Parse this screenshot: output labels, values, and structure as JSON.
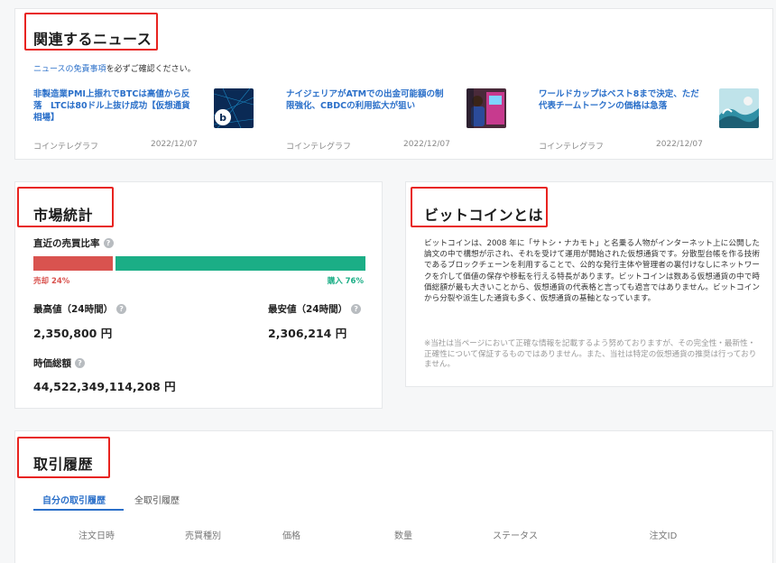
{
  "news": {
    "title": "関連するニュース",
    "disclaimer_link": "ニュースの免責事項",
    "disclaimer_text": "を必ずご確認ください。",
    "items": [
      {
        "title": "非製造業PMI上振れでBTCは高値から反落　LTCは80ドル上抜け成功【仮想通貨相場】",
        "source": "コインテレグラフ",
        "date": "2022/12/07",
        "thumb": "bitbank-logo"
      },
      {
        "title": "ナイジェリアがATMでの出金可能額の制限強化、CBDCの利用拡大が狙い",
        "source": "コインテレグラフ",
        "date": "2022/12/07",
        "thumb": "atm-photo"
      },
      {
        "title": "ワールドカップはベスト8まで決定、ただ代表チームトークンの価格は急落",
        "source": "コインテレグラフ",
        "date": "2022/12/07",
        "thumb": "wave-photo"
      }
    ]
  },
  "stats": {
    "title": "市場統計",
    "ratio_label": "直近の売買比率",
    "sell_label": "売却 24%",
    "buy_label": "購入 76%",
    "sell_pct": 24,
    "buy_pct": 76,
    "high_label": "最高値（24時間）",
    "high_value": "2,350,800 円",
    "low_label": "最安値（24時間）",
    "low_value": "2,306,214 円",
    "cap_label": "時価総額",
    "cap_value": "44,522,349,114,208 円",
    "help_glyph": "?",
    "colors": {
      "sell": "#d9534f",
      "buy": "#1bae86"
    }
  },
  "bitcoin": {
    "title": "ビットコインとは",
    "description": "ビットコインは、2008 年に「サトシ・ナカモト」と名乗る人物がインターネット上に公開した論文の中で構想が示され、それを受けて運用が開始された仮想通貨です。分散型台帳を作る技術であるブロックチェーンを利用することで、公的な発行主体や管理者の裏付けなしにネットワークを介して価値の保存や移転を行える特長があります。ビットコインは数ある仮想通貨の中で時価総額が最も大きいことから、仮想通貨の代表格と言っても過言ではありません。ビットコインから分裂や派生した通貨も多く、仮想通貨の基軸となっています。",
    "note": "※当社は当ページにおいて正確な情報を記載するよう努めておりますが、その完全性・最新性・正確性について保証するものではありません。また、当社は特定の仮想通貨の推奨は行っておりません。"
  },
  "trade": {
    "title": "取引履歴",
    "tabs": [
      "自分の取引履歴",
      "全取引履歴"
    ],
    "columns": [
      "注文日時",
      "売買種別",
      "価格",
      "数量",
      "ステータス",
      "注文ID"
    ]
  },
  "accent_color": "#2a6fc9",
  "highlight_color": "#e8231f"
}
